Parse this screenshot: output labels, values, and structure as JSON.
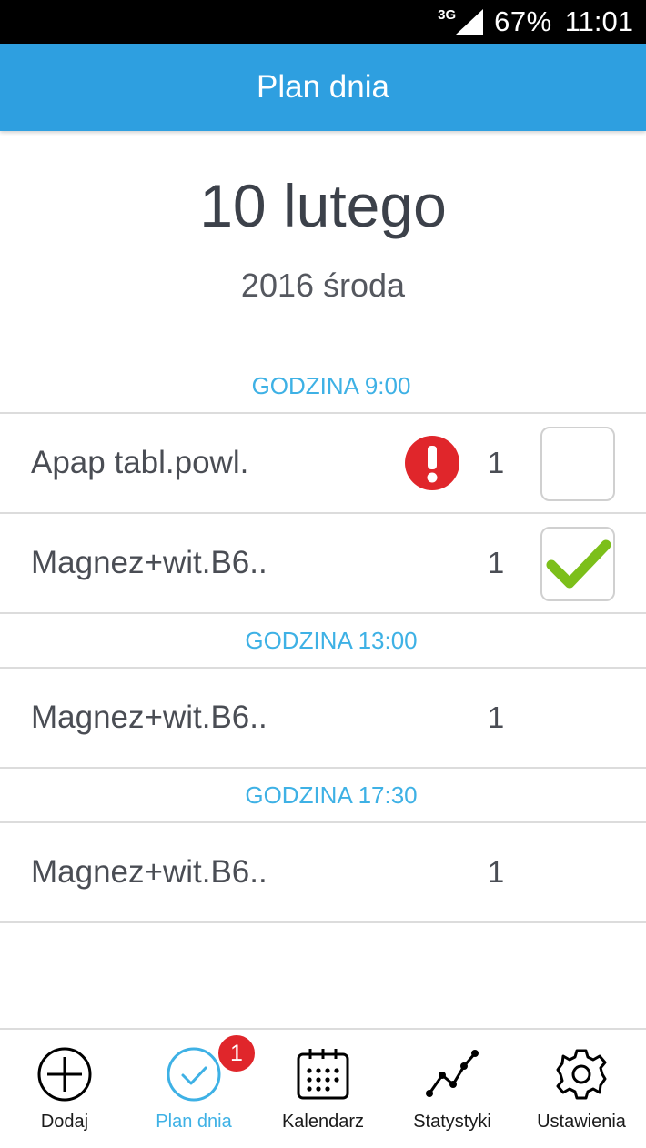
{
  "status_bar": {
    "network": "3G",
    "battery": "67%",
    "time": "11:01"
  },
  "app_bar": {
    "title": "Plan dnia"
  },
  "date": {
    "day_month": "10 lutego",
    "year_weekday": "2016 środa"
  },
  "schedule": [
    {
      "header": "GODZINA 9:00",
      "items": [
        {
          "name": "Apap tabl.powl.",
          "qty": "1",
          "warning": true,
          "checkbox": "unchecked"
        },
        {
          "name": "Magnez+wit.B6..",
          "qty": "1",
          "warning": false,
          "checkbox": "checked"
        }
      ]
    },
    {
      "header": "GODZINA 13:00",
      "items": [
        {
          "name": "Magnez+wit.B6..",
          "qty": "1",
          "warning": false,
          "checkbox": "none"
        }
      ]
    },
    {
      "header": "GODZINA 17:30",
      "items": [
        {
          "name": "Magnez+wit.B6..",
          "qty": "1",
          "warning": false,
          "checkbox": "none"
        }
      ]
    }
  ],
  "bottom_nav": {
    "items": [
      {
        "label": "Dodaj",
        "icon": "plus-circle-icon"
      },
      {
        "label": "Plan dnia",
        "icon": "check-circle-icon",
        "active": true
      },
      {
        "label": "Kalendarz",
        "icon": "calendar-icon"
      },
      {
        "label": "Statystyki",
        "icon": "line-chart-icon"
      },
      {
        "label": "Ustawienia",
        "icon": "gear-icon"
      }
    ],
    "badge": "1"
  },
  "colors": {
    "accent": "#2e9fe0",
    "header_text": "#3eb1e5",
    "warning": "#e0262b",
    "check": "#7cbf1a"
  }
}
